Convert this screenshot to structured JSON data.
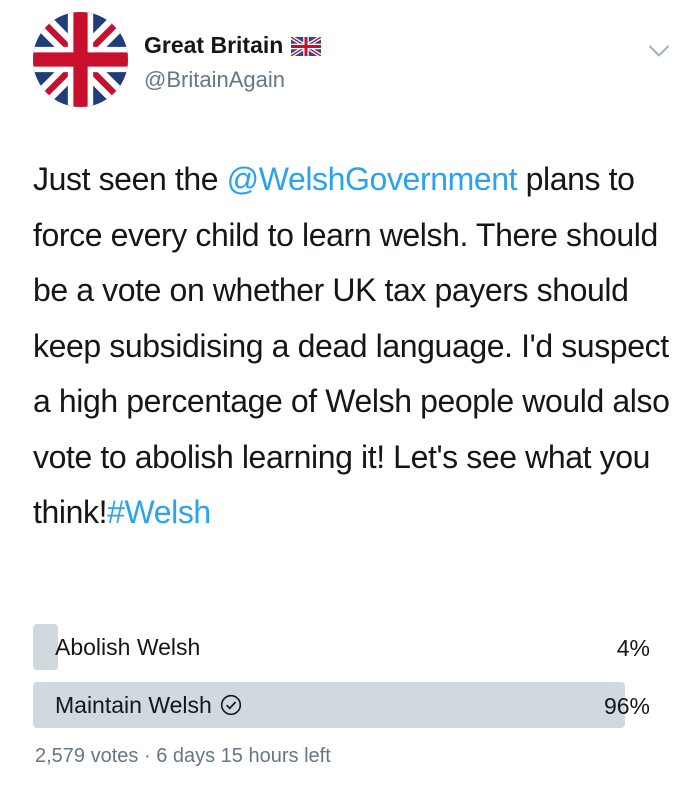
{
  "account": {
    "display_name": "Great Britain",
    "handle": "@BritainAgain",
    "avatar_icon": "union-jack-flag-icon",
    "name_badge_icon": "union-jack-flag-emoji-icon"
  },
  "menu": {
    "icon": "chevron-down-icon"
  },
  "tweet": {
    "text_part1": "Just seen the ",
    "mention": "@WelshGovernment",
    "text_part2": " plans to force every child to learn welsh. There should be a vote on whether UK tax payers should keep subsidising a dead language. I'd suspect a high percentage of Welsh people would also vote to abolish learning it! Let's see what you think!",
    "hashtag": "#Welsh",
    "link_color": "#2aa3ef"
  },
  "poll": {
    "options": [
      {
        "label": "Abolish Welsh",
        "percent_label": "4%",
        "percent": 4,
        "selected": false
      },
      {
        "label": "Maintain Welsh",
        "percent_label": "96%",
        "percent": 96,
        "selected": true,
        "selected_icon": "check-circle-icon"
      }
    ],
    "bar_color": "#cfd9de",
    "votes": "2,579 votes",
    "separator": " · ",
    "time_left": "6 days 15 hours left"
  }
}
